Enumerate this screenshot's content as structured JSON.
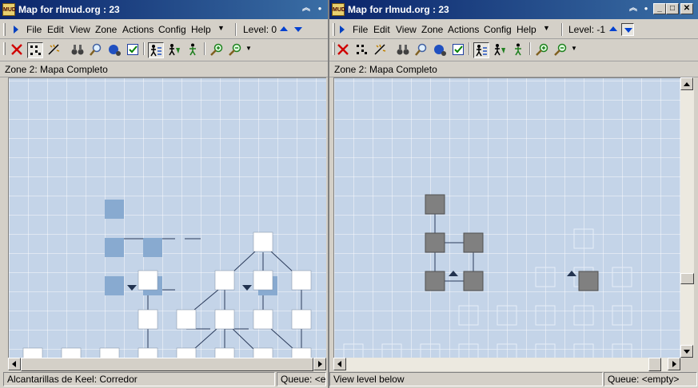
{
  "left_window": {
    "title": "Map for rlmud.org : 23",
    "menu": [
      "File",
      "Edit",
      "View",
      "Zone",
      "Actions",
      "Config",
      "Help"
    ],
    "level_label": "Level: 0",
    "zone_label": "Zone 2: Mapa Completo",
    "status_text": "Alcantarillas de Keel: Corredor",
    "queue_text": "Queue: <er"
  },
  "right_window": {
    "title": "Map for rlmud.org : 23",
    "menu": [
      "File",
      "Edit",
      "View",
      "Zone",
      "Actions",
      "Config",
      "Help"
    ],
    "level_label": "Level: -1",
    "zone_label": "Zone 2: Mapa Completo",
    "status_text": "View level below",
    "queue_text": "Queue: <empty>"
  },
  "icons": {
    "app": "mud-app-icon",
    "title_buttons": [
      "rollup-icon",
      "pin-icon",
      "minimize-icon",
      "maximize-icon",
      "close-icon"
    ],
    "tools": [
      "delete-icon",
      "select-rooms-icon",
      "edit-path-icon",
      "binoculars-icon",
      "find-icon",
      "speedwalk-icon",
      "checkbox-icon",
      "create-room-icon",
      "create-path-icon",
      "walk-icon",
      "zoom-in-icon",
      "zoom-out-icon",
      "dropdown-icon"
    ]
  },
  "colors": {
    "titlebar_start": "#0a246a",
    "titlebar_end": "#3a6ea5",
    "map_background": "#c4d4e8",
    "room_current_level": "#ffffff",
    "room_other_level": "#88aad0",
    "room_selected": "#808080",
    "level_arrow": "#0040d0"
  },
  "glyphs": {
    "app_badge": "MUD",
    "rollup": "︽",
    "pin": "●",
    "minimize": "_",
    "maximize": "□",
    "close": "✕",
    "chevron": "▼"
  }
}
